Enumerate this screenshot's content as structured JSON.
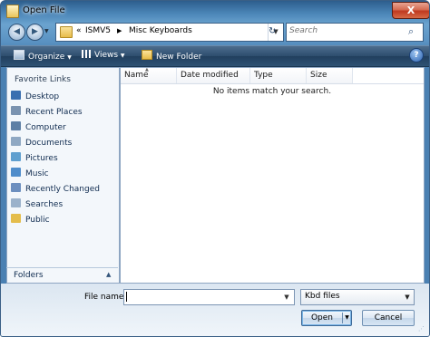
{
  "window": {
    "title": "Open File",
    "close_label": "X"
  },
  "address": {
    "overflow": "«",
    "crumb1": "ISMV5",
    "sep": "▶",
    "crumb2": "Misc Keyboards"
  },
  "search": {
    "placeholder": "Search"
  },
  "toolbar": {
    "organize": "Organize",
    "views": "Views",
    "new_folder": "New Folder",
    "help": "?"
  },
  "left_pane": {
    "header": "Favorite Links",
    "items": [
      {
        "label": "Desktop",
        "icon": "desktop-icon",
        "color": "#3a6fb0"
      },
      {
        "label": "Recent Places",
        "icon": "recent-places-icon",
        "color": "#7a93b0"
      },
      {
        "label": "Computer",
        "icon": "computer-icon",
        "color": "#5d7fa5"
      },
      {
        "label": "Documents",
        "icon": "documents-icon",
        "color": "#8fa8c3"
      },
      {
        "label": "Pictures",
        "icon": "pictures-icon",
        "color": "#5f9fcf"
      },
      {
        "label": "Music",
        "icon": "music-icon",
        "color": "#4f8dcb"
      },
      {
        "label": "Recently Changed",
        "icon": "recently-changed-icon",
        "color": "#6c8fbf"
      },
      {
        "label": "Searches",
        "icon": "searches-icon",
        "color": "#9bb2cb"
      },
      {
        "label": "Public",
        "icon": "public-folder-icon",
        "color": "#e4bd4c"
      }
    ],
    "folders_label": "Folders"
  },
  "list": {
    "columns": [
      "Name",
      "Date modified",
      "Type",
      "Size"
    ],
    "empty_message": "No items match your search."
  },
  "bottom": {
    "filename_label": "File name:",
    "filename_value": "",
    "filter_value": "Kbd files",
    "open_label": "Open",
    "cancel_label": "Cancel"
  }
}
